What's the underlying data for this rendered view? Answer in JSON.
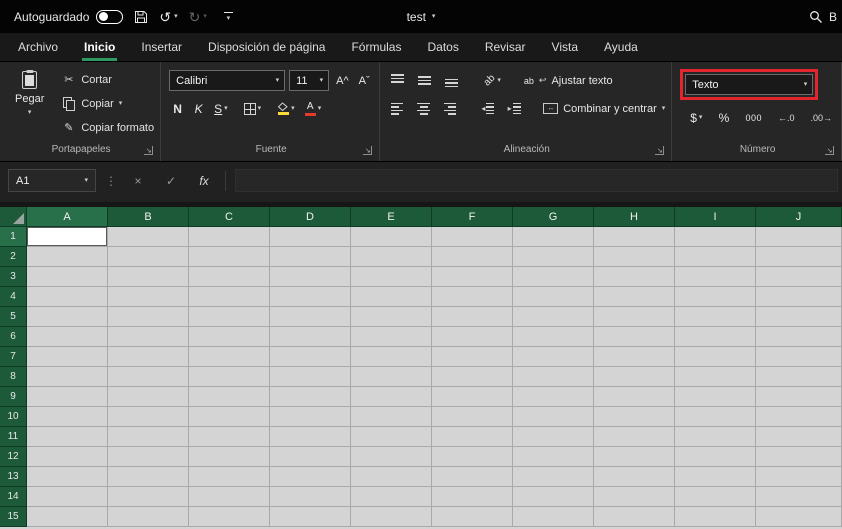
{
  "titlebar": {
    "autosave_label": "Autoguardado",
    "document_title": "test",
    "search_text": "B"
  },
  "tabs": [
    {
      "label": "Archivo",
      "active": false
    },
    {
      "label": "Inicio",
      "active": true
    },
    {
      "label": "Insertar",
      "active": false
    },
    {
      "label": "Disposición de página",
      "active": false
    },
    {
      "label": "Fórmulas",
      "active": false
    },
    {
      "label": "Datos",
      "active": false
    },
    {
      "label": "Revisar",
      "active": false
    },
    {
      "label": "Vista",
      "active": false
    },
    {
      "label": "Ayuda",
      "active": false
    }
  ],
  "ribbon": {
    "clipboard": {
      "group_label": "Portapapeles",
      "paste_label": "Pegar",
      "cut_label": "Cortar",
      "copy_label": "Copiar",
      "format_painter_label": "Copiar formato"
    },
    "font": {
      "group_label": "Fuente",
      "font_name": "Calibri",
      "font_size": "11",
      "bold": "N",
      "italic": "K",
      "underline": "S",
      "increase_font": "A^",
      "decrease_font": "Aˇ"
    },
    "alignment": {
      "group_label": "Alineación",
      "orientation_icon_text": "ab",
      "wrap_text_label": "Ajustar texto",
      "merge_center_label": "Combinar y centrar"
    },
    "number": {
      "group_label": "Número",
      "format_value": "Texto",
      "currency": "$",
      "percent": "%",
      "thousands": "000",
      "increase_decimal": "←.0",
      "decrease_decimal": ".00→"
    }
  },
  "formula_bar": {
    "name_box_value": "A1",
    "divider_dots": "⋮",
    "cancel": "×",
    "enter": "✓",
    "fx": "fx",
    "formula_value": ""
  },
  "grid": {
    "columns": [
      "A",
      "B",
      "C",
      "D",
      "E",
      "F",
      "G",
      "H",
      "I",
      "J"
    ],
    "rows": [
      "1",
      "2",
      "3",
      "4",
      "5",
      "6",
      "7",
      "8",
      "9",
      "10",
      "11",
      "12",
      "13",
      "14",
      "15"
    ],
    "selected_cell": "A1"
  },
  "icons": {
    "chevron": "▾",
    "undo": "↺",
    "redo": "↻",
    "scissors": "✂",
    "brush": "✎",
    "launcher": "↘",
    "merge_arrows": "↔",
    "wrap_ab": "ab",
    "wrap_return": "↩",
    "indent_left": "◂",
    "indent_right": "▸"
  },
  "colors": {
    "excel_green": "#217346",
    "header_green": "#1d5a39",
    "active_tab_underline": "#2e9a62",
    "highlight_red": "#e3262d",
    "fill_yellow": "#ffd937",
    "font_color_red": "#e23b2e"
  }
}
